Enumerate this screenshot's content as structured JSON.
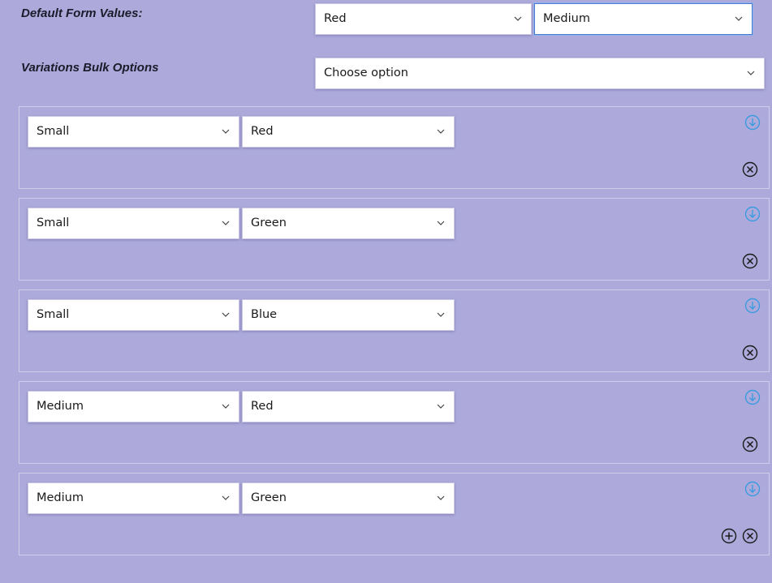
{
  "default_form_values": {
    "label": "Default Form Values:",
    "color_value": "Red",
    "size_value": "Medium"
  },
  "bulk_options": {
    "label": "Variations Bulk Options",
    "value": "Choose option"
  },
  "variations": [
    {
      "size": "Small",
      "color": "Red"
    },
    {
      "size": "Small",
      "color": "Green"
    },
    {
      "size": "Small",
      "color": "Blue"
    },
    {
      "size": "Medium",
      "color": "Red"
    },
    {
      "size": "Medium",
      "color": "Green"
    }
  ],
  "icons": {
    "expand": "arrow-down-circle-icon",
    "remove": "close-circle-icon",
    "add": "plus-circle-icon"
  },
  "colors": {
    "background": "#adaadb",
    "expand_icon": "#3b9be0",
    "remove_icon": "#1a1a1a"
  }
}
